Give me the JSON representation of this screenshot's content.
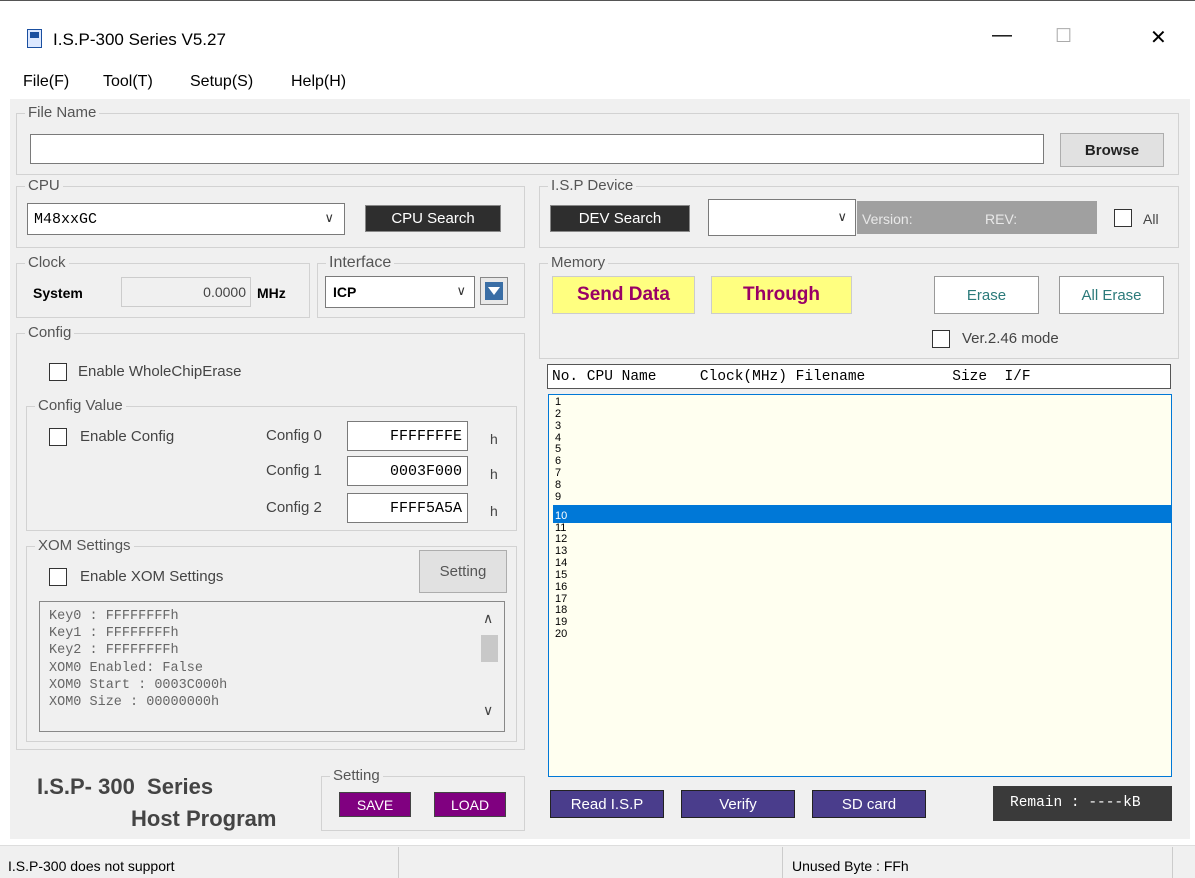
{
  "window": {
    "title": "I.S.P-300 Series V5.27",
    "minimize": "—",
    "maximize": "☐",
    "close": "✕"
  },
  "menu": [
    "File(F)",
    "Tool(T)",
    "Setup(S)",
    "Help(H)"
  ],
  "file_group": {
    "label": "File Name",
    "value": "",
    "browse": "Browse"
  },
  "cpu_group": {
    "label": "CPU",
    "selected": "M48xxGC",
    "search": "CPU Search"
  },
  "isp_device": {
    "label": "I.S.P Device",
    "search": "DEV Search",
    "selected": "",
    "version_label": "Version:",
    "rev_label": "REV:",
    "all_label": "All"
  },
  "clock_group": {
    "label": "Clock",
    "system_label": "System",
    "value": "0.0000",
    "unit": "MHz"
  },
  "interface_group": {
    "label": "Interface",
    "selected": "ICP"
  },
  "memory_group": {
    "label": "Memory",
    "send_data": "Send Data",
    "through": "Through",
    "erase": "Erase",
    "all_erase": "All Erase",
    "ver_mode": "Ver.2.46 mode"
  },
  "config_group": {
    "label": "Config",
    "whole_chip_erase": "Enable WholeChipErase"
  },
  "config_value": {
    "label": "Config Value",
    "enable": "Enable Config",
    "rows": [
      {
        "label": "Config 0",
        "value": "FFFFFFFE",
        "unit": "h"
      },
      {
        "label": "Config 1",
        "value": "0003F000",
        "unit": "h"
      },
      {
        "label": "Config 2",
        "value": "FFFF5A5A",
        "unit": "h"
      }
    ]
  },
  "xom": {
    "label": "XOM Settings",
    "enable": "Enable XOM Settings",
    "setting": "Setting",
    "lines": [
      "Key0 : FFFFFFFFh",
      "Key1 : FFFFFFFFh",
      "Key2 : FFFFFFFFh",
      "XOM0 Enabled: False",
      "XOM0 Start : 0003C000h",
      "XOM0 Size : 00000000h"
    ]
  },
  "branding": {
    "line1": "I.S.P- 300  Series",
    "line2": "Host Program"
  },
  "setting_group": {
    "label": "Setting",
    "save": "SAVE",
    "load": "LOAD"
  },
  "table": {
    "header": "No. CPU Name     Clock(MHz) Filename          Size  I/F",
    "rows": [
      "1",
      "2",
      "3",
      "4",
      "5",
      "6",
      "7",
      "8",
      "9",
      "10",
      "11",
      "12",
      "13",
      "14",
      "15",
      "16",
      "17",
      "18",
      "19",
      "20"
    ],
    "selected_row": "10"
  },
  "bottom_buttons": {
    "read": "Read I.S.P",
    "verify": "Verify",
    "sd": "SD card",
    "remain": "Remain : ----kB"
  },
  "status": {
    "left": "I.S.P-300 does not support",
    "right": "Unused Byte : FFh"
  },
  "colors": {
    "dark_button": "#2e2e2e",
    "yellow": "#ffff80",
    "magenta_text": "#990066",
    "purple": "#4a3d8c",
    "save_load": "#800080",
    "selection": "#0078d7",
    "list_bg": "#fffff0",
    "panel": "#f0f0f0"
  }
}
